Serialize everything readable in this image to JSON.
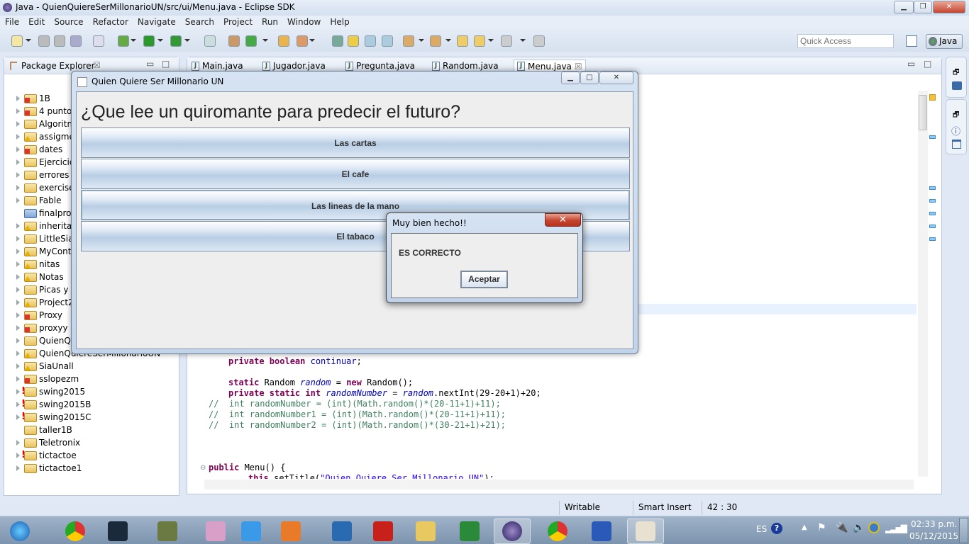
{
  "window": {
    "title": "Java - QuienQuiereSerMillonarioUN/src/ui/Menu.java - Eclipse SDK"
  },
  "menu": [
    "File",
    "Edit",
    "Source",
    "Refactor",
    "Navigate",
    "Search",
    "Project",
    "Run",
    "Window",
    "Help"
  ],
  "quick_access": {
    "placeholder": "Quick Access"
  },
  "perspective": {
    "label": "Java"
  },
  "package_explorer": {
    "title": "Package Explorer",
    "projects": [
      {
        "name": "1B",
        "state": "err"
      },
      {
        "name": "4 punto",
        "state": "err"
      },
      {
        "name": "Algoritm",
        "state": "ok"
      },
      {
        "name": "assigmer",
        "state": "warn"
      },
      {
        "name": "dates",
        "state": "err"
      },
      {
        "name": "Ejercicio",
        "state": "ok"
      },
      {
        "name": "errores",
        "state": "ok"
      },
      {
        "name": "exercises",
        "state": "ok"
      },
      {
        "name": "Fable",
        "state": "ok"
      },
      {
        "name": "finalproj",
        "state": "closed"
      },
      {
        "name": "inheritan",
        "state": "warn"
      },
      {
        "name": "LittleSia",
        "state": "ok"
      },
      {
        "name": "MyConta",
        "state": "warn"
      },
      {
        "name": "nitas",
        "state": "warn"
      },
      {
        "name": "Notas",
        "state": "warn"
      },
      {
        "name": "Picas y F",
        "state": "ok"
      },
      {
        "name": "Project2",
        "state": "warn"
      },
      {
        "name": "Proxy",
        "state": "err"
      },
      {
        "name": "proxyy",
        "state": "err"
      },
      {
        "name": "QuienQu",
        "state": "ok"
      },
      {
        "name": "QuienQuiereSerMillonarioUN",
        "state": "warn"
      },
      {
        "name": "SiaUnall",
        "state": "warn"
      },
      {
        "name": "sslopezm",
        "state": "err"
      },
      {
        "name": "swing2015",
        "state": "excl"
      },
      {
        "name": "swing2015B",
        "state": "excl"
      },
      {
        "name": "swing2015C",
        "state": "excl"
      },
      {
        "name": "taller1B",
        "state": "ok"
      },
      {
        "name": "Teletronix",
        "state": "ok"
      },
      {
        "name": "tictactoe",
        "state": "excl"
      },
      {
        "name": "tictactoe1",
        "state": "ok"
      }
    ]
  },
  "editor": {
    "tabs": [
      {
        "label": "Main.java"
      },
      {
        "label": "Jugador.java"
      },
      {
        "label": "Pregunta.java"
      },
      {
        "label": "Random.java"
      },
      {
        "label": "Menu.java",
        "active": true
      }
    ],
    "code": {
      "l1": {
        "kw": "private boolean ",
        "fld": "continuar",
        "rest": ";"
      },
      "l2": {
        "kw": "static ",
        "a": "Random ",
        "fld": "random",
        "b": " = ",
        "kw2": "new ",
        "c": "Random();"
      },
      "l3": {
        "kw": "private static int ",
        "fld": "randomNumber",
        "b": " = ",
        "fld2": "random",
        "c": ".nextInt(29-20+1)+20;"
      },
      "c1": "//  int randomNumber = (int)(Math.random()*(20-11+1)+11);",
      "c2": "//  int randomNumber1 = (int)(Math.random()*(20-11+1)+11);",
      "c3": "//  int randomNumber2 = (int)(Math.random()*(30-21+1)+21);",
      "l4": {
        "kw": "public ",
        "rest": "Menu() {"
      },
      "l5": {
        "kw": "this",
        "a": ".setTitle(",
        "str": "\"Quien Quiere Ser Millonario UN\"",
        "b": ");"
      }
    }
  },
  "status": {
    "writable": "Writable",
    "insert_mode": "Smart Insert",
    "position": "42 : 30"
  },
  "swing_app": {
    "title": "Quien Quiere Ser Millonario UN",
    "question": "¿Que lee un quiromante para predecir el futuro?",
    "options": [
      "Las cartas",
      "El cafe",
      "Las lineas de la mano",
      "El tabaco"
    ]
  },
  "dialog": {
    "title": "Muy bien hecho!!",
    "message": "ES CORRECTO",
    "button": "Aceptar"
  },
  "taskbar": {
    "apps": [
      "start",
      "chrome",
      "league-of-legends",
      "halo",
      "game",
      "internet-explorer",
      "media-player",
      "store",
      "acrobat",
      "file-explorer",
      "excel",
      "eclipse",
      "chrome",
      "word",
      "java"
    ],
    "language": "ES",
    "time": "02:33 p.m.",
    "date": "05/12/2015"
  },
  "colors": {
    "keyword": "#7f0055",
    "field": "#0000c0",
    "comment": "#3f7f5f",
    "string": "#2a00ff"
  }
}
